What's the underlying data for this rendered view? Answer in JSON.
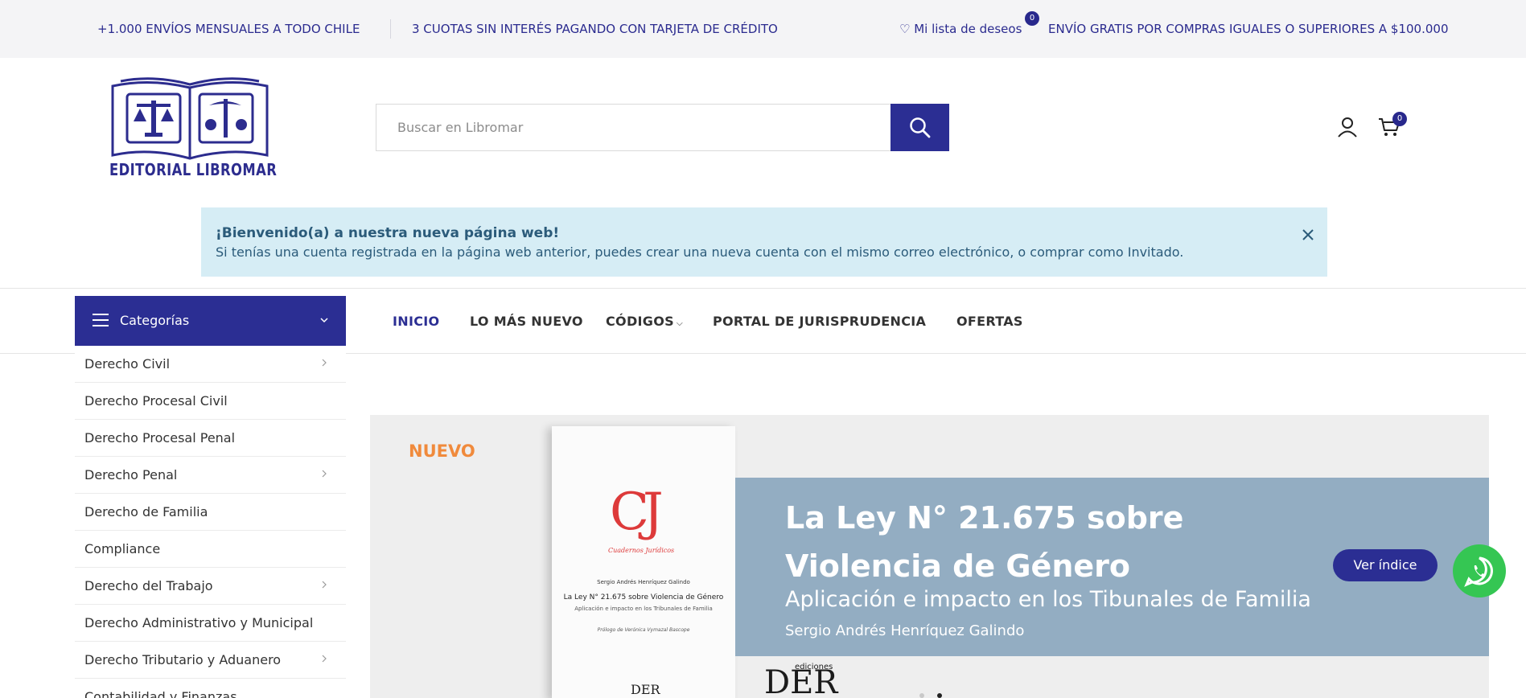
{
  "topbar": {
    "shipping": "+1.000 ENVÍOS MENSUALES A TODO CHILE",
    "installments": "3 CUOTAS SIN INTERÉS PAGANDO CON TARJETA DE CRÉDITO",
    "wishlist_label": "♡ Mi lista de deseos",
    "wishlist_count": "0",
    "free_shipping": "ENVÍO GRATIS POR COMPRAS IGUALES O SUPERIORES A $100.000"
  },
  "header": {
    "logo_text": "EDITORIAL LIBROMAR",
    "search_placeholder": "Buscar en Libromar",
    "cart_count": "0",
    "icons": [
      "search-icon",
      "user-icon",
      "cart-icon"
    ]
  },
  "notice": {
    "title": "¡Bienvenido(a) a nuestra nueva página web!",
    "body": "Si tenías una cuenta registrada en la página web anterior, puedes crear una nueva cuenta con el mismo correo electrónico, o comprar como Invitado."
  },
  "nav": {
    "categories_label": "Categorías",
    "menu": [
      {
        "label": "INICIO",
        "active": true
      },
      {
        "label": "LO MÁS NUEVO",
        "active": false
      },
      {
        "label": "CÓDIGOS",
        "active": false,
        "has_dropdown": true
      },
      {
        "label": "PORTAL DE JURISPRUDENCIA",
        "active": false
      },
      {
        "label": "OFERTAS",
        "active": false
      }
    ]
  },
  "sidebar": {
    "items": [
      {
        "label": "Derecho Civil",
        "has_sub": true
      },
      {
        "label": "Derecho Procesal Civil",
        "has_sub": false
      },
      {
        "label": "Derecho Procesal Penal",
        "has_sub": false
      },
      {
        "label": "Derecho Penal",
        "has_sub": true
      },
      {
        "label": "Derecho de Familia",
        "has_sub": false
      },
      {
        "label": "Compliance",
        "has_sub": false
      },
      {
        "label": "Derecho del Trabajo",
        "has_sub": true
      },
      {
        "label": "Derecho Administrativo y Municipal",
        "has_sub": false
      },
      {
        "label": "Derecho Tributario y Aduanero",
        "has_sub": true
      },
      {
        "label": "Contabilidad y Finanzas",
        "has_sub": false
      }
    ]
  },
  "banner": {
    "badge": "NUEVO",
    "book": {
      "logo": "CJ",
      "series": "Cuadernos Jurídicos",
      "author": "Sergio Andrés Henríquez Galindo",
      "title": "La Ley N° 21.675 sobre Violencia de Género",
      "subtitle": "Aplicación e impacto en los Tribunales de Familia",
      "prologue": "Prólogo de Verónica Vymazal Bascope",
      "publisher": "DER"
    },
    "headline_line1": "La Ley N° 21.675 sobre",
    "headline_line2": "Violencia de Género",
    "subheadline": "Aplicación e impacto en los Tibunales de Familia",
    "author": "Sergio Andrés Henríquez Galindo",
    "publisher_small": "ediciones",
    "publisher": "DER",
    "cta": "Ver índice"
  },
  "colors": {
    "brand": "#2b2e93",
    "accent_orange": "#f08a3c",
    "banner_band": "#93adc2",
    "notice_bg": "#d6edf5",
    "whatsapp": "#35c653"
  }
}
